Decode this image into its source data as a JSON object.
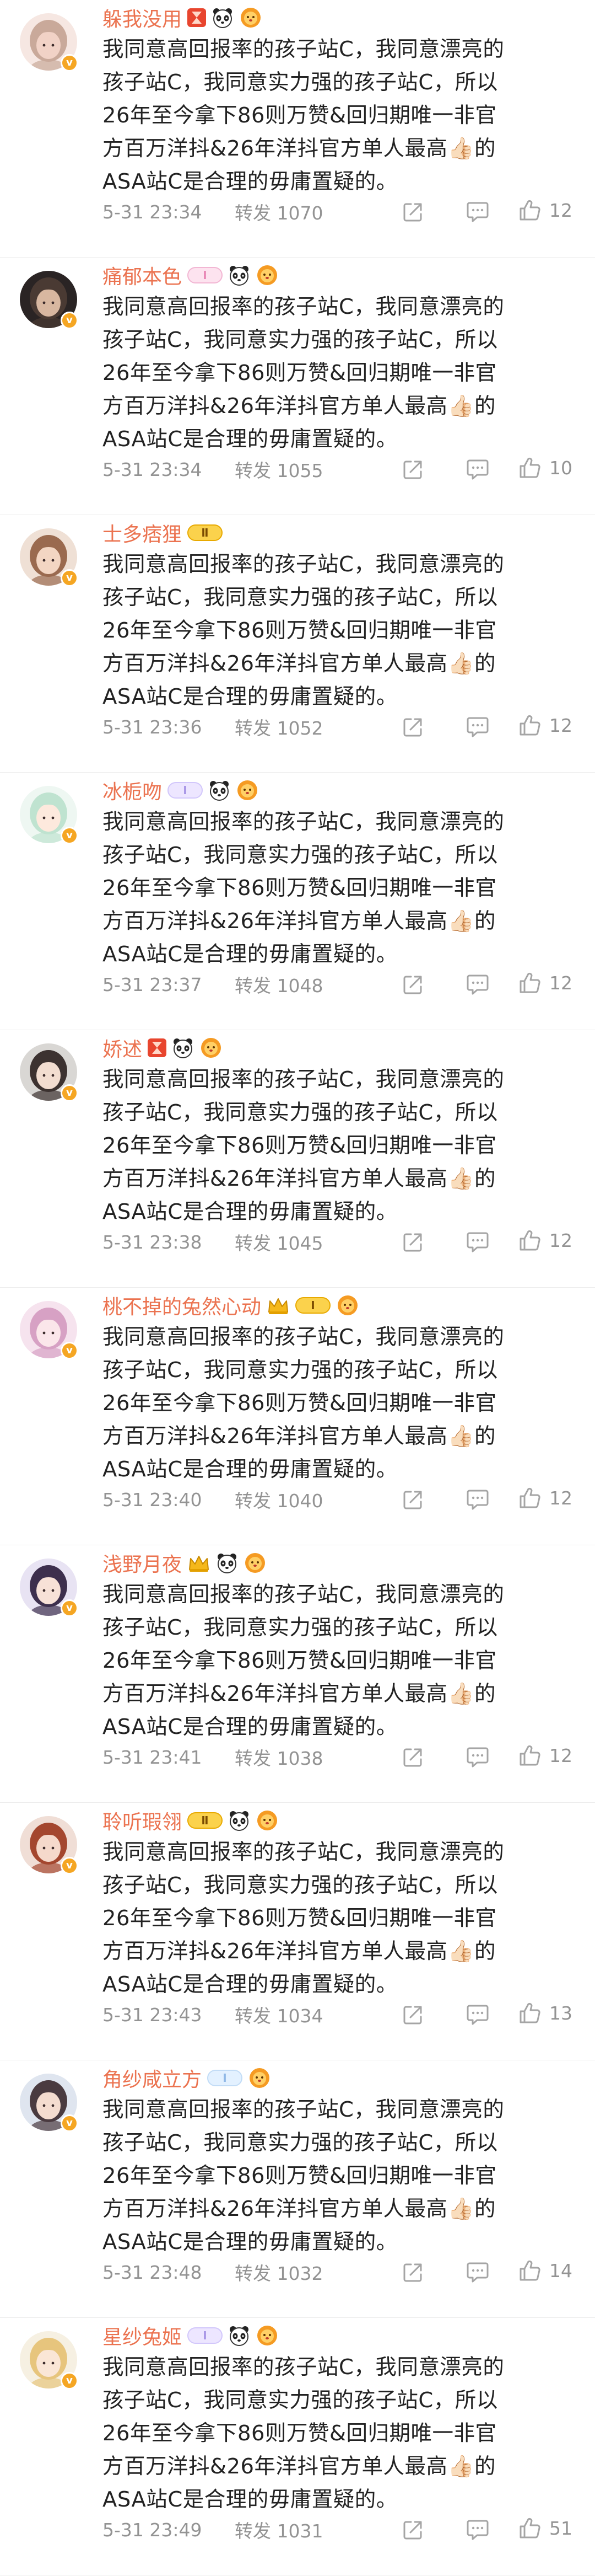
{
  "colors": {
    "username": "#eb7350",
    "meta_text": "#939393",
    "body_text": "#222222",
    "verified_badge": "#f5a623"
  },
  "feed": {
    "posts": [
      {
        "username": "躲我没用",
        "badges": [
          "hourglass-badge-icon",
          "panda-badge-icon",
          "lion-badge-icon"
        ],
        "level": "",
        "avatar_style": "pale-hair",
        "content": "我同意高回报率的孩子站C，我同意漂亮的\n孩子站C，我同意实力强的孩子站C，所以\n26年至今拿下86则万赞&回归期唯一非官\n方百万洋抖&26年洋抖官方单人最高👍🏻的\nASA站C是合理的毋庸置疑的。",
        "time": "5-31 23:34",
        "repost": "转发 1070",
        "likes": "12"
      },
      {
        "username": "痛郁本色",
        "badges": [
          "panda-badge-icon",
          "lion-badge-icon"
        ],
        "level": "Ⅰ",
        "level_style": "pink",
        "avatar_style": "dark",
        "content": "我同意高回报率的孩子站C，我同意漂亮的\n孩子站C，我同意实力强的孩子站C，所以\n26年至今拿下86则万赞&回归期唯一非官\n方百万洋抖&26年洋抖官方单人最高👍🏻的\nASA站C是合理的毋庸置疑的。",
        "time": "5-31 23:34",
        "repost": "转发 1055",
        "likes": "10"
      },
      {
        "username": "士多痞狸",
        "badges": [],
        "level": "Ⅱ",
        "level_style": "gold",
        "avatar_style": "brown-hair",
        "content": "我同意高回报率的孩子站C，我同意漂亮的\n孩子站C，我同意实力强的孩子站C，所以\n26年至今拿下86则万赞&回归期唯一非官\n方百万洋抖&26年洋抖官方单人最高👍🏻的\nASA站C是合理的毋庸置疑的。",
        "time": "5-31 23:36",
        "repost": "转发 1052",
        "likes": "12"
      },
      {
        "username": "冰栀吻",
        "badges": [
          "panda-badge-icon",
          "lion-badge-icon"
        ],
        "level": "Ⅰ",
        "level_style": "violet",
        "avatar_style": "anime-green",
        "content": "我同意高回报率的孩子站C，我同意漂亮的\n孩子站C，我同意实力强的孩子站C，所以\n26年至今拿下86则万赞&回归期唯一非官\n方百万洋抖&26年洋抖官方单人最高👍🏻的\nASA站C是合理的毋庸置疑的。",
        "time": "5-31 23:37",
        "repost": "转发 1048",
        "likes": "12"
      },
      {
        "username": "娇述",
        "badges": [
          "hourglass-badge-icon",
          "panda-badge-icon",
          "lion-badge-icon"
        ],
        "level": "",
        "avatar_style": "dark-hair",
        "content": "我同意高回报率的孩子站C，我同意漂亮的\n孩子站C，我同意实力强的孩子站C，所以\n26年至今拿下86则万赞&回归期唯一非官\n方百万洋抖&26年洋抖官方单人最高👍🏻的\nASA站C是合理的毋庸置疑的。",
        "time": "5-31 23:38",
        "repost": "转发 1045",
        "likes": "12"
      },
      {
        "username": "桃不掉的兔然心动",
        "badges": [
          "crown-badge-icon",
          "lion-badge-icon"
        ],
        "level": "Ⅰ",
        "level_style": "gold",
        "avatar_style": "pink-anime",
        "content": "我同意高回报率的孩子站C，我同意漂亮的\n孩子站C，我同意实力强的孩子站C，所以\n26年至今拿下86则万赞&回归期唯一非官\n方百万洋抖&26年洋抖官方单人最高👍🏻的\nASA站C是合理的毋庸置疑的。",
        "time": "5-31 23:40",
        "repost": "转发 1040",
        "likes": "12"
      },
      {
        "username": "浅野月夜",
        "badges": [
          "crown-badge-icon",
          "panda-badge-icon",
          "lion-badge-icon"
        ],
        "level": "",
        "avatar_style": "purple-anime",
        "content": "我同意高回报率的孩子站C，我同意漂亮的\n孩子站C，我同意实力强的孩子站C，所以\n26年至今拿下86则万赞&回归期唯一非官\n方百万洋抖&26年洋抖官方单人最高👍🏻的\nASA站C是合理的毋庸置疑的。",
        "time": "5-31 23:41",
        "repost": "转发 1038",
        "likes": "12"
      },
      {
        "username": "聆听瑕翎",
        "badges": [
          "panda-badge-icon",
          "lion-badge-icon"
        ],
        "level": "Ⅱ",
        "level_style": "gold",
        "avatar_style": "red-hair",
        "content": "我同意高回报率的孩子站C，我同意漂亮的\n孩子站C，我同意实力强的孩子站C，所以\n26年至今拿下86则万赞&回归期唯一非官\n方百万洋抖&26年洋抖官方单人最高👍🏻的\nASA站C是合理的毋庸置疑的。",
        "time": "5-31 23:43",
        "repost": "转发 1034",
        "likes": "13"
      },
      {
        "username": "角纱咸立方",
        "badges": [
          "lion-badge-icon"
        ],
        "level": "Ⅰ",
        "level_style": "blue",
        "avatar_style": "ponytail",
        "content": "我同意高回报率的孩子站C，我同意漂亮的\n孩子站C，我同意实力强的孩子站C，所以\n26年至今拿下86则万赞&回归期唯一非官\n方百万洋抖&26年洋抖官方单人最高👍🏻的\nASA站C是合理的毋庸置疑的。",
        "time": "5-31 23:48",
        "repost": "转发 1032",
        "likes": "14"
      },
      {
        "username": "星纱兔姬",
        "badges": [
          "panda-badge-icon",
          "lion-badge-icon"
        ],
        "level": "Ⅰ",
        "level_style": "violet",
        "avatar_style": "blonde",
        "content": "我同意高回报率的孩子站C，我同意漂亮的\n孩子站C，我同意实力强的孩子站C，所以\n26年至今拿下86则万赞&回归期唯一非官\n方百万洋抖&26年洋抖官方单人最高👍🏻的\nASA站C是合理的毋庸置疑的。",
        "time": "5-31 23:49",
        "repost": "转发 1031",
        "likes": "51"
      }
    ]
  }
}
